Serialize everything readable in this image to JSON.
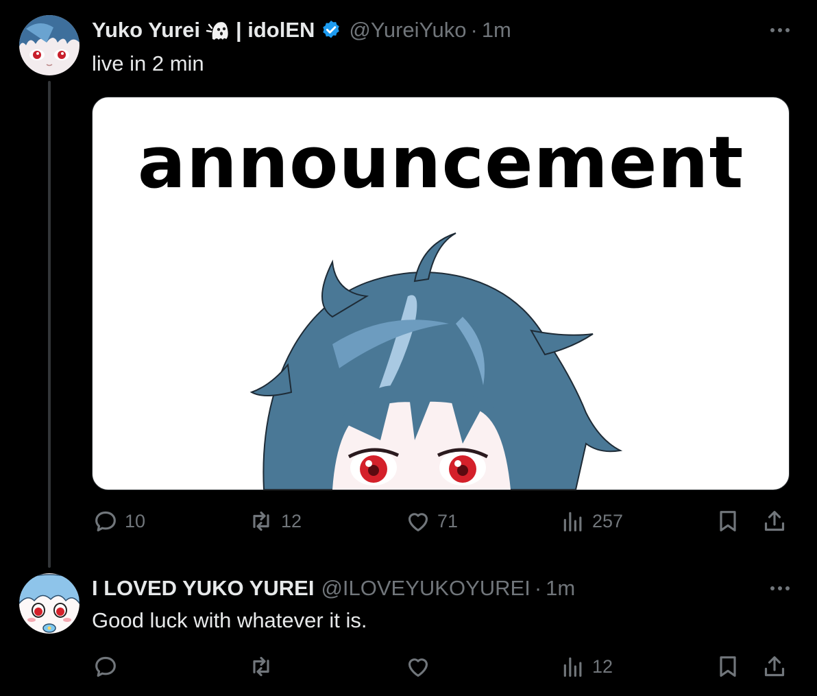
{
  "tweet1": {
    "display_name": "Yuko Yurei",
    "name_suffix": "| idolEN",
    "handle": "@YureiYuko",
    "separator": "·",
    "time": "1m",
    "text": "live in 2 min",
    "media_text": "announcement",
    "verified": true,
    "actions": {
      "replies": "10",
      "reposts": "12",
      "likes": "71",
      "views": "257"
    }
  },
  "tweet2": {
    "display_name": "I LOVED YUKO YUREI",
    "handle": "@ILOVEYUKOYUREI",
    "separator": "·",
    "time": "1m",
    "text": "Good luck with whatever it is.",
    "actions": {
      "views": "12"
    }
  },
  "colors": {
    "background": "#000000",
    "text_primary": "#e7e9ea",
    "text_secondary": "#71767b",
    "verified_badge": "#1d9bf0",
    "hair": "#4a7896",
    "eyes": "#d4202a"
  },
  "icons": [
    "ghost-icon",
    "verified-badge-icon",
    "more-icon",
    "reply-icon",
    "repost-icon",
    "like-icon",
    "views-icon",
    "bookmark-icon",
    "share-icon"
  ]
}
